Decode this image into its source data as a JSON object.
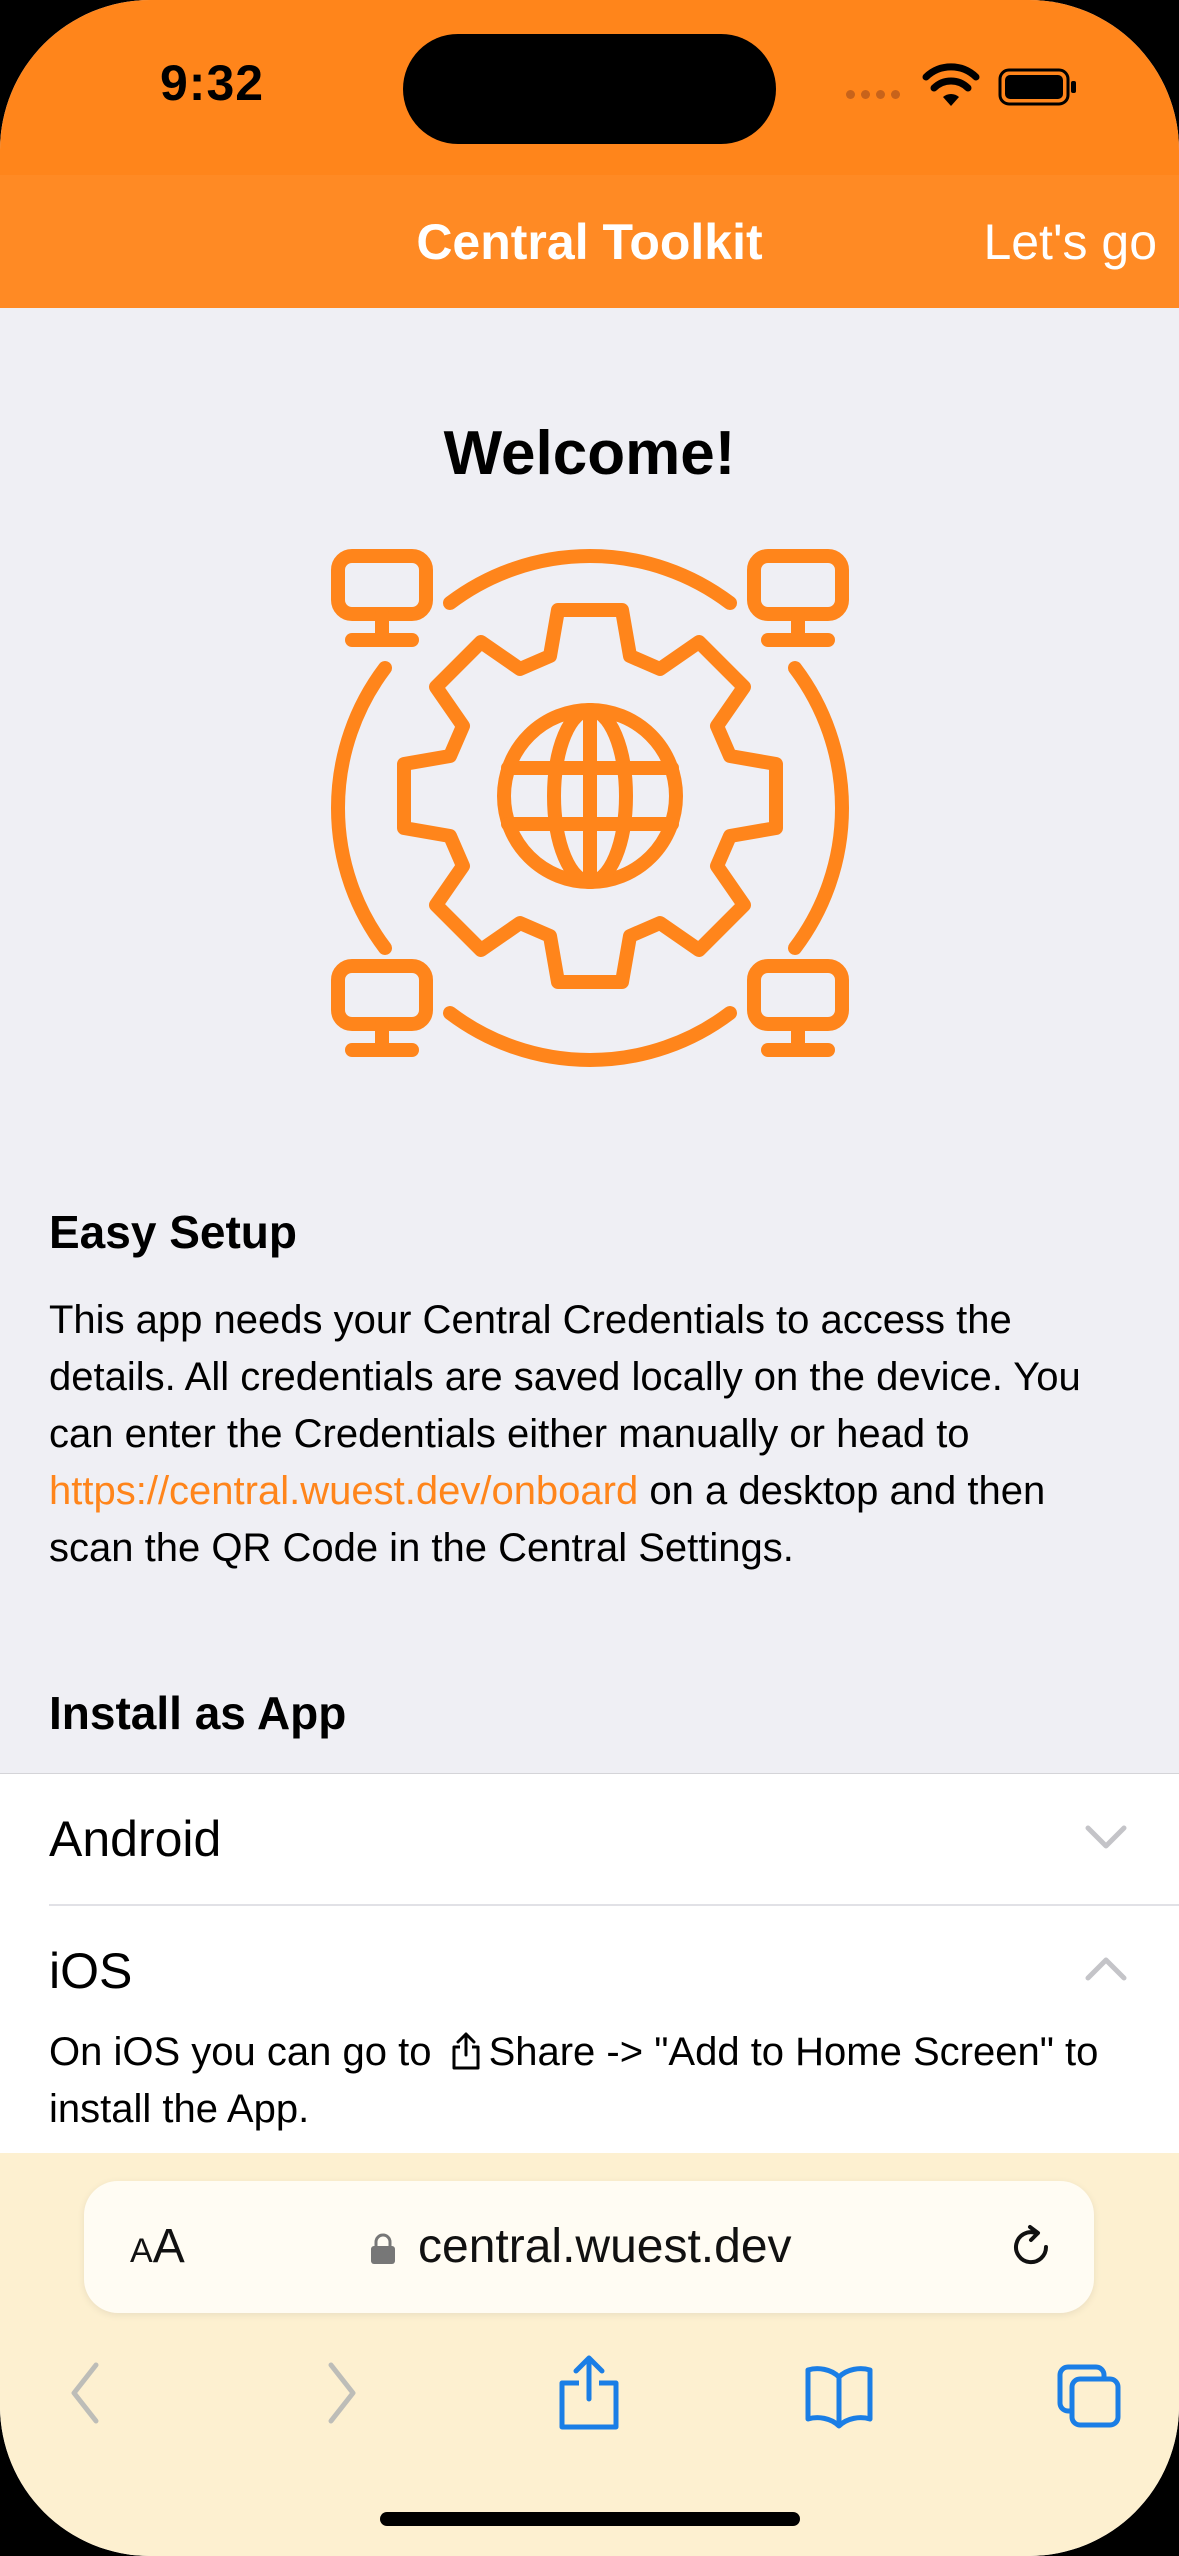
{
  "status_bar": {
    "time": "9:32"
  },
  "nav": {
    "title": "Central Toolkit",
    "action": "Let's go"
  },
  "welcome": {
    "title": "Welcome!",
    "hero_icon": "gear-globe-network-icon"
  },
  "easy_setup": {
    "title": "Easy Setup",
    "text_before_link": "This app needs your Central Credentials to access the details. All credentials are saved locally on the device. You can enter the Credentials either manually or head to ",
    "link": "https://central.wuest.dev/onboard",
    "text_after_link": " on a desktop and then scan the QR Code in the Central Settings."
  },
  "install": {
    "title": "Install as App",
    "items": [
      {
        "label": "Android",
        "expanded": false
      },
      {
        "label": "iOS",
        "expanded": true
      }
    ],
    "ios_text_before": "On iOS you can go to ",
    "ios_text_after": "Share -> \"Add to Home Screen\" to install the App."
  },
  "browser": {
    "text_size": "AA",
    "url": "central.wuest.dev"
  },
  "colors": {
    "accent": "#ff851b",
    "background": "#efeff4",
    "toolbar": "#fdf0d0",
    "toolbar_icon": "#1a7ee6"
  }
}
